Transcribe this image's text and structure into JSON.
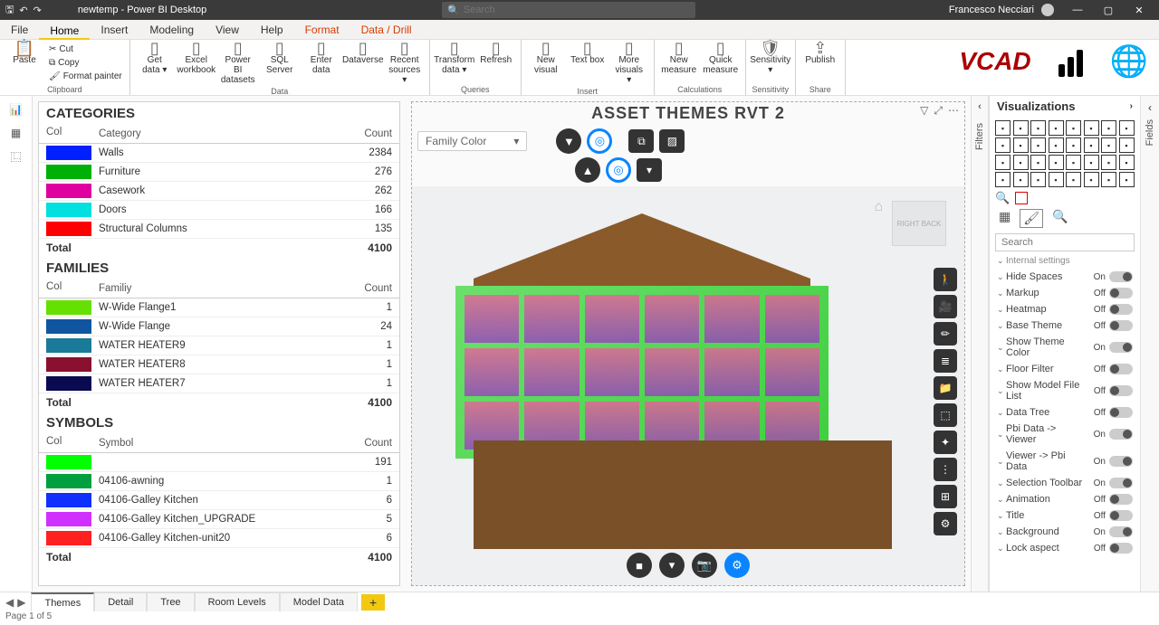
{
  "app": {
    "title": "newtemp - Power BI Desktop",
    "user": "Francesco Necciari",
    "search_placeholder": "Search",
    "status": "Page 1 of 5"
  },
  "menu": [
    "File",
    "Home",
    "Insert",
    "Modeling",
    "View",
    "Help",
    "Format",
    "Data / Drill"
  ],
  "menu_active": 1,
  "menu_orange": [
    6,
    7
  ],
  "ribbon": {
    "clipboard": {
      "label": "Clipboard",
      "paste": "Paste",
      "cut": "Cut",
      "copy": "Copy",
      "painter": "Format painter"
    },
    "data": {
      "label": "Data",
      "items": [
        "Get data ▾",
        "Excel workbook",
        "Power BI datasets",
        "SQL Server",
        "Enter data",
        "Dataverse",
        "Recent sources ▾"
      ]
    },
    "queries": {
      "label": "Queries",
      "items": [
        "Transform data ▾",
        "Refresh"
      ]
    },
    "insert": {
      "label": "Insert",
      "items": [
        "New visual",
        "Text box",
        "More visuals ▾"
      ]
    },
    "calc": {
      "label": "Calculations",
      "items": [
        "New measure",
        "Quick measure"
      ]
    },
    "sens": {
      "label": "Sensitivity",
      "item": "Sensitivity ▾"
    },
    "share": {
      "label": "Share",
      "item": "Publish"
    }
  },
  "visual_title": "ASSET THEMES RVT 2",
  "dropdown_selected": "Family Color",
  "sections": {
    "categories": {
      "title": "CATEGORIES",
      "headers": [
        "Col",
        "Category",
        "Count"
      ],
      "total": "4100",
      "total_label": "Total",
      "rows": [
        {
          "color": "#0020ff",
          "name": "Walls",
          "count": "2384"
        },
        {
          "color": "#00b007",
          "name": "Furniture",
          "count": "276"
        },
        {
          "color": "#e000a0",
          "name": "Casework",
          "count": "262"
        },
        {
          "color": "#00e0e0",
          "name": "Doors",
          "count": "166"
        },
        {
          "color": "#ff0000",
          "name": "Structural Columns",
          "count": "135"
        }
      ]
    },
    "families": {
      "title": "FAMILIES",
      "headers": [
        "Col",
        "Familiy",
        "Count"
      ],
      "total": "4100",
      "total_label": "Total",
      "rows": [
        {
          "color": "#66e000",
          "name": "W-Wide Flange1",
          "count": "1"
        },
        {
          "color": "#1055a0",
          "name": "W-Wide Flange",
          "count": "24"
        },
        {
          "color": "#1a7a9a",
          "name": "WATER HEATER9",
          "count": "1"
        },
        {
          "color": "#8a1030",
          "name": "WATER HEATER8",
          "count": "1"
        },
        {
          "color": "#0a0a50",
          "name": "WATER HEATER7",
          "count": "1"
        }
      ]
    },
    "symbols": {
      "title": "SYMBOLS",
      "headers": [
        "Col",
        "Symbol",
        "Count"
      ],
      "total": "4100",
      "total_label": "Total",
      "rows": [
        {
          "color": "#00ff00",
          "name": "",
          "count": "191"
        },
        {
          "color": "#009f3f",
          "name": "04106-awning",
          "count": "1"
        },
        {
          "color": "#1030ff",
          "name": "04106-Galley Kitchen",
          "count": "6"
        },
        {
          "color": "#d030ff",
          "name": "04106-Galley Kitchen_UPGRADE",
          "count": "5"
        },
        {
          "color": "#ff2020",
          "name": "04106-Galley Kitchen-unit20",
          "count": "6"
        }
      ]
    }
  },
  "right_tools": [
    "person",
    "camera",
    "pencil",
    "layers",
    "folder",
    "cube",
    "connect",
    "levels",
    "tree",
    "gear"
  ],
  "bottom_tools": [
    "stop",
    "filter",
    "camera",
    "gear"
  ],
  "vis_pane": {
    "title": "Visualizations",
    "search_placeholder": "Search",
    "section_top": "Internal settings",
    "props": [
      {
        "name": "Hide Spaces",
        "state": "On"
      },
      {
        "name": "Markup",
        "state": "Off"
      },
      {
        "name": "Heatmap",
        "state": "Off"
      },
      {
        "name": "Base Theme",
        "state": "Off"
      },
      {
        "name": "Show Theme Color",
        "state": "On"
      },
      {
        "name": "Floor Filter",
        "state": "Off"
      },
      {
        "name": "Show Model File List",
        "state": "Off"
      },
      {
        "name": "Data Tree",
        "state": "Off"
      },
      {
        "name": "Pbi Data -> Viewer",
        "state": "On"
      },
      {
        "name": "Viewer -> Pbi Data",
        "state": "On"
      },
      {
        "name": "Selection Toolbar",
        "state": "On"
      },
      {
        "name": "Animation",
        "state": "Off"
      },
      {
        "name": "Title",
        "state": "Off"
      },
      {
        "name": "Background",
        "state": "On"
      },
      {
        "name": "Lock aspect",
        "state": "Off"
      }
    ]
  },
  "filters_label": "Filters",
  "fields_label": "Fields",
  "sheets": [
    "Themes",
    "Detail",
    "Tree",
    "Room Levels",
    "Model Data"
  ],
  "sheets_active": 0
}
